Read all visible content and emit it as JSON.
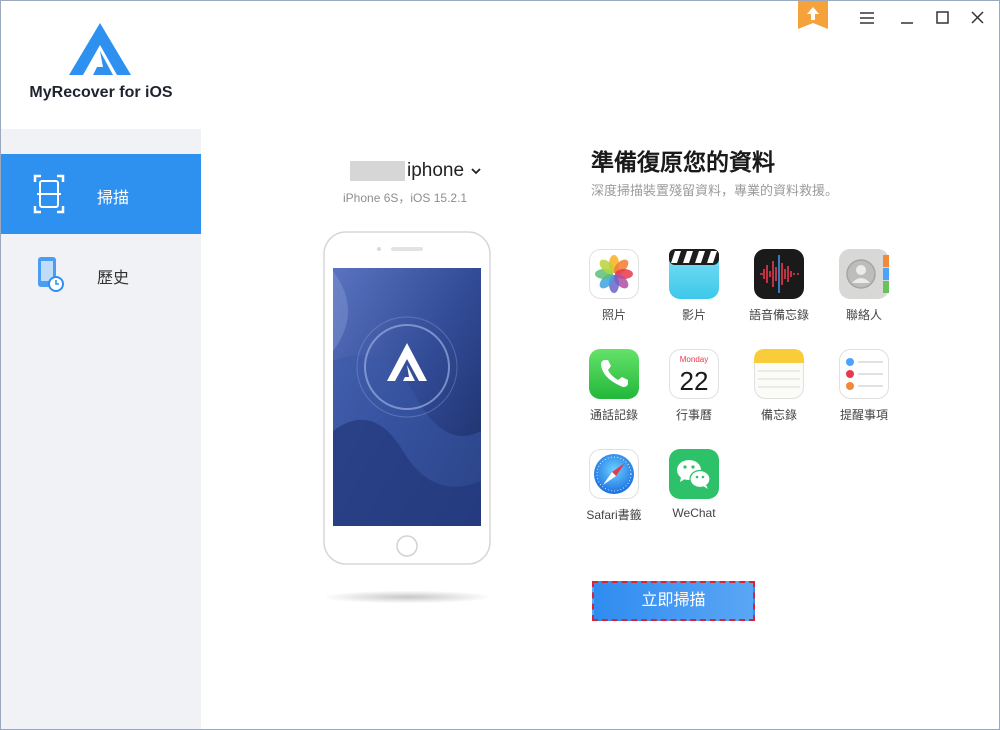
{
  "app": {
    "name": "MyRecover for iOS"
  },
  "sidebar": {
    "items": [
      {
        "label": "掃描",
        "icon": "scan-icon",
        "active": true
      },
      {
        "label": "歷史",
        "icon": "history-icon",
        "active": false
      }
    ]
  },
  "window_controls": [
    "upgrade-icon",
    "menu-icon",
    "minimize-icon",
    "maximize-icon",
    "close-icon"
  ],
  "device": {
    "name": "iphone",
    "info": "iPhone 6S，iOS 15.2.1"
  },
  "main": {
    "title": "準備復原您的資料",
    "subtitle": "深度掃描裝置殘留資料，專業的資料救援。",
    "categories": [
      {
        "label": "照片",
        "icon": "photos-icon"
      },
      {
        "label": "影片",
        "icon": "videos-icon"
      },
      {
        "label": "語音備忘錄",
        "icon": "voice-memos-icon"
      },
      {
        "label": "聯絡人",
        "icon": "contacts-icon"
      },
      {
        "label": "通話記錄",
        "icon": "phone-icon"
      },
      {
        "label": "行事曆",
        "icon": "calendar-icon"
      },
      {
        "label": "備忘錄",
        "icon": "notes-icon"
      },
      {
        "label": "提醒事項",
        "icon": "reminders-icon"
      },
      {
        "label": "Safari書籤",
        "icon": "safari-icon"
      },
      {
        "label": "WeChat",
        "icon": "wechat-icon"
      }
    ],
    "calendar": {
      "weekday": "Monday",
      "day": "22"
    },
    "scan_button": "立即掃描"
  },
  "colors": {
    "accent": "#2f91ef",
    "sidebar_bg": "#f0f2f5",
    "highlight_border": "#d6243a"
  }
}
